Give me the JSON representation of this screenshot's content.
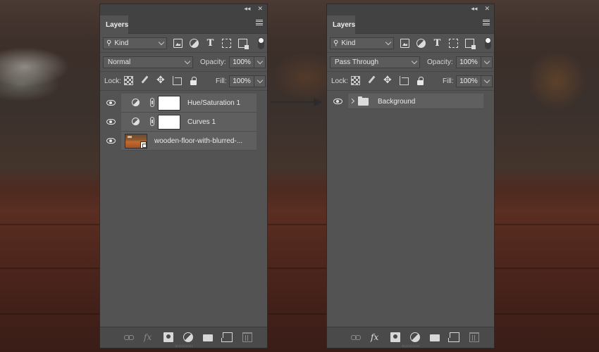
{
  "before_panel": {
    "tab_label": "Layers",
    "topbar": {
      "collapse_glyph": "◂◂",
      "close_glyph": "✕"
    },
    "filter": {
      "kind_label": "Kind",
      "icons": [
        "pixel-filter-icon",
        "adjustment-filter-icon",
        "type-filter-icon",
        "shape-filter-icon",
        "smart-object-filter-icon"
      ]
    },
    "blend_mode": "Normal",
    "opacity_label": "Opacity:",
    "opacity_value": "100%",
    "lock_label": "Lock:",
    "fill_label": "Fill:",
    "fill_value": "100%",
    "layers": [
      {
        "name": "Hue/Saturation 1",
        "type": "adjustment",
        "visible": true
      },
      {
        "name": "Curves 1",
        "type": "adjustment",
        "visible": true
      },
      {
        "name": "wooden-floor-with-blurred-...",
        "type": "smart-object",
        "visible": true
      }
    ]
  },
  "after_panel": {
    "tab_label": "Layers",
    "topbar": {
      "collapse_glyph": "◂◂",
      "close_glyph": "✕"
    },
    "filter": {
      "kind_label": "Kind"
    },
    "blend_mode": "Pass Through",
    "opacity_label": "Opacity:",
    "opacity_value": "100%",
    "lock_label": "Lock:",
    "fill_label": "Fill:",
    "fill_value": "100%",
    "layers": [
      {
        "name": "Background",
        "type": "group",
        "visible": true,
        "expanded": false
      }
    ]
  },
  "colors": {
    "panel_bg": "#535353",
    "panel_dark": "#424242",
    "layer_row": "#5f5f5f",
    "arrow": "#2b2b2b"
  }
}
